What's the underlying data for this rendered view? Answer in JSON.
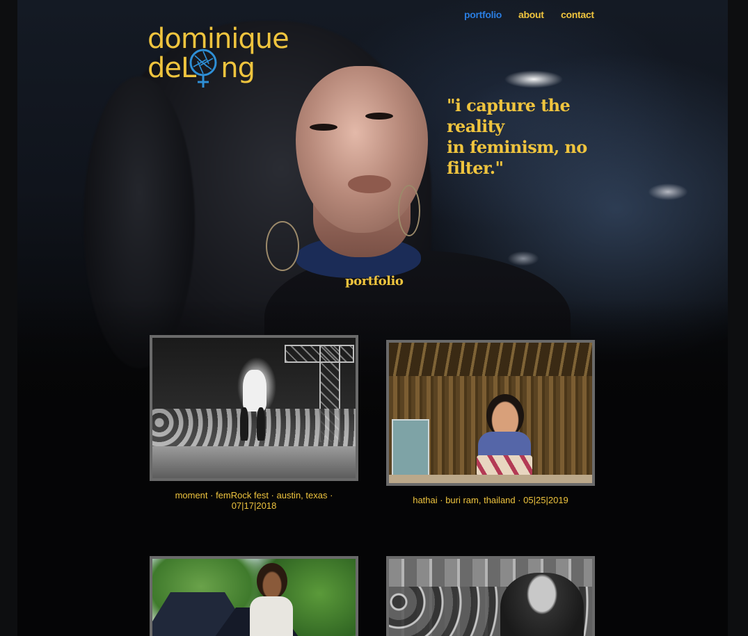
{
  "nav": {
    "items": [
      {
        "label": "portfolio",
        "active": true
      },
      {
        "label": "about",
        "active": false
      },
      {
        "label": "contact",
        "active": false
      }
    ]
  },
  "brand": {
    "line1": "dominique",
    "line2_prefix": "deL",
    "line2_suffix": "ng",
    "logo_icon": "aperture-female-icon"
  },
  "hero": {
    "quote_lines": [
      "\"i capture the",
      "reality",
      "in feminism, no",
      "filter.\""
    ]
  },
  "section": {
    "title": "portfolio"
  },
  "gallery": [
    {
      "caption_line1": "moment · femRock fest · austin, texas ·",
      "caption_line2": "07|17|2018",
      "style": "bw"
    },
    {
      "caption_line1": "hathai ·  buri ram, thailand · 05|25|2019",
      "caption_line2": "",
      "style": "color"
    },
    {
      "caption_line1": "",
      "caption_line2": "",
      "style": "color"
    },
    {
      "caption_line1": "",
      "caption_line2": "",
      "style": "bw"
    }
  ],
  "colors": {
    "accent_yellow": "#efc43e",
    "active_blue": "#2a7de0",
    "logo_blue": "#2e8fd6",
    "frame_gray": "#6a6a6a",
    "background": "#050506"
  }
}
